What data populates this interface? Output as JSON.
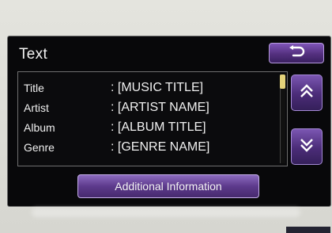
{
  "screen": {
    "title": "Text",
    "back_icon": "return-arrow-icon"
  },
  "track_info": {
    "rows": [
      {
        "label": "Title",
        "value": ": [MUSIC TITLE]"
      },
      {
        "label": "Artist",
        "value": ": [ARTIST NAME]"
      },
      {
        "label": "Album",
        "value": ": [ALBUM TITLE]"
      },
      {
        "label": "Genre",
        "value": ": [GENRE NAME]"
      }
    ]
  },
  "scroll": {
    "up_icon": "double-chevron-up-icon",
    "down_icon": "double-chevron-down-icon",
    "thumb_color": "#e3d27a"
  },
  "buttons": {
    "additional_information": "Additional Information"
  },
  "colors": {
    "accent": "#5d3a8c",
    "screen_bg": "#08080a"
  }
}
